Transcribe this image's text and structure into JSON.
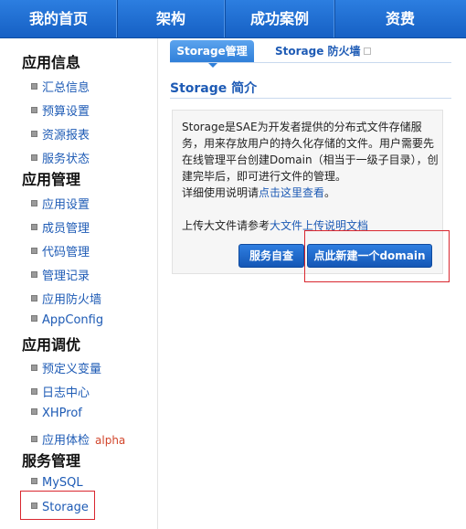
{
  "topnav": {
    "items": [
      "我的首页",
      "架构",
      "成功案例",
      "资费"
    ]
  },
  "sidebar": {
    "sections": [
      {
        "title": "应用信息",
        "items": [
          "汇总信息",
          "预算设置",
          "资源报表",
          "服务状态"
        ]
      },
      {
        "title": "应用管理",
        "items": [
          "应用设置",
          "成员管理",
          "代码管理",
          "管理记录",
          "应用防火墙",
          "AppConfig"
        ]
      },
      {
        "title": "应用调优",
        "items": [
          "预定义变量",
          "日志中心",
          "XHProf",
          "应用体检"
        ],
        "tag": "alpha"
      },
      {
        "title": "服务管理",
        "items": [
          "MySQL",
          "Storage"
        ]
      }
    ]
  },
  "main": {
    "tabs": [
      "Storage管理",
      "Storage 防火墙"
    ],
    "title": "Storage 简介",
    "intro": {
      "p1": "Storage是SAE为开发者提供的分布式文件存储服务，用来存放用户的持久化存储的文件。用户需要先在线管理平台创建Domain（相当于一级子目录），创建完毕后，即可进行文件的管理。",
      "p2_prefix": "详细使用说明请",
      "p2_link": "点击这里查看",
      "p2_suffix": "。",
      "p3_prefix": "上传大文件请参考",
      "p3_link": "大文件上传说明文档"
    },
    "buttons": {
      "self_check": "服务自查",
      "new_domain": "点此新建一个domain"
    }
  }
}
